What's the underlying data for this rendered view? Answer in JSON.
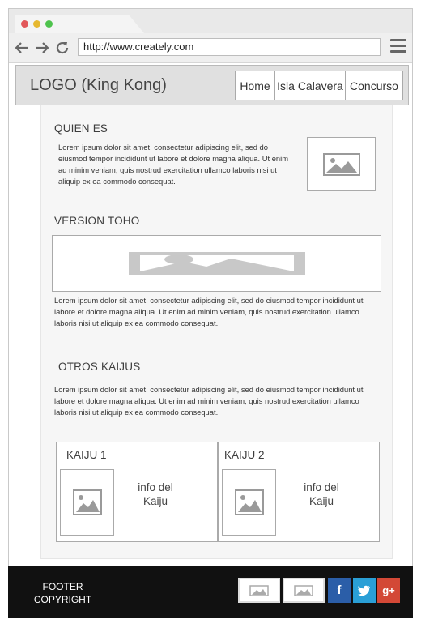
{
  "browser": {
    "url": "http://www.creately.com",
    "dots": [
      "#e2575a",
      "#e6b830",
      "#4ec34d"
    ]
  },
  "header": {
    "logo": "LOGO (King Kong)",
    "nav": [
      "Home",
      "Isla Calavera",
      "Concurso"
    ]
  },
  "sections": {
    "quien_es": {
      "title": "QUIEN ES",
      "text": "Lorem ipsum dolor sit amet, consectetur adipiscing elit, sed do eiusmod tempor incididunt ut labore et dolore magna aliqua. Ut enim ad minim veniam, quis nostrud exercitation ullamco laboris nisi ut aliquip ex ea commodo consequat."
    },
    "version_toho": {
      "title": "VERSION TOHO",
      "text": "Lorem ipsum dolor sit amet, consectetur adipiscing elit, sed do eiusmod tempor incididunt ut labore et dolore magna aliqua. Ut enim ad minim veniam, quis nostrud exercitation ullamco laboris nisi ut aliquip ex ea commodo consequat."
    },
    "otros_kaijus": {
      "title": "OTROS KAIJUS",
      "text": "Lorem ipsum dolor sit amet, consectetur adipiscing elit, sed do eiusmod tempor incididunt ut labore et dolore magna aliqua. Ut enim ad minim veniam, quis nostrud exercitation ullamco laboris nisi ut aliquip ex ea commodo consequat."
    }
  },
  "kaijus": [
    {
      "title": "KAIJU 1",
      "info_line1": "info del",
      "info_line2": "Kaiju"
    },
    {
      "title": "KAIJU 2",
      "info_line1": "info del",
      "info_line2": "Kaiju"
    }
  ],
  "footer": {
    "line1": "FOOTER",
    "line2": "COPYRIGHT",
    "social": [
      {
        "icon": "facebook-icon",
        "glyph": "f",
        "color": "#2b5ea8"
      },
      {
        "icon": "twitter-icon",
        "glyph": "t",
        "color": "#2a9fd6"
      },
      {
        "icon": "google-plus-icon",
        "glyph": "g+",
        "color": "#d34836"
      }
    ]
  }
}
